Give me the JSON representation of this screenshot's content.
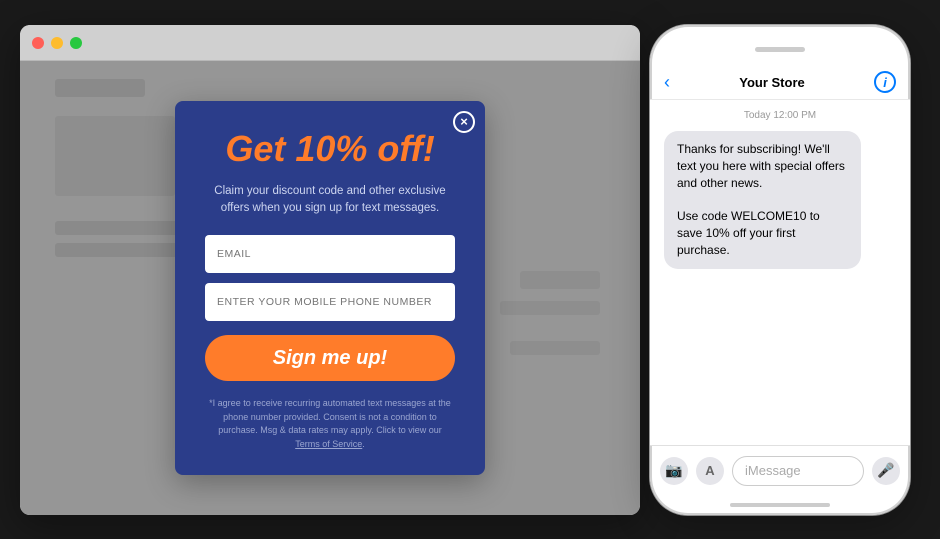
{
  "browser": {
    "buttons": {
      "close": "close",
      "minimize": "minimize",
      "maximize": "maximize"
    }
  },
  "modal": {
    "headline": "Get 10% off!",
    "subtext": "Claim your discount code and other exclusive offers when you sign up for text messages.",
    "email_placeholder": "EMAIL",
    "phone_placeholder": "ENTER YOUR MOBILE PHONE NUMBER",
    "cta_label": "Sign me up!",
    "disclaimer": "*I agree to receive recurring automated text messages at the phone number provided. Consent is not a condition to purchase. Msg & data rates may apply. Click to view our",
    "terms_link": "Terms of Service",
    "close_icon": "×"
  },
  "iphone": {
    "nav": {
      "back_icon": "‹",
      "store_name": "Your Store",
      "info_icon": "i"
    },
    "chat": {
      "date_label": "Today 12:00 PM",
      "bubble_text": "Thanks for subscribing! We'll text you here with special offers and other news.\n\nUse code WELCOME10 to save 10% off your first purchase."
    },
    "input": {
      "placeholder": "iMessage",
      "camera_icon": "📷",
      "apps_icon": "A"
    }
  },
  "colors": {
    "modal_bg": "#2b3d8a",
    "accent": "#ff7c2a",
    "bubble_bg": "#e5e5ea"
  }
}
